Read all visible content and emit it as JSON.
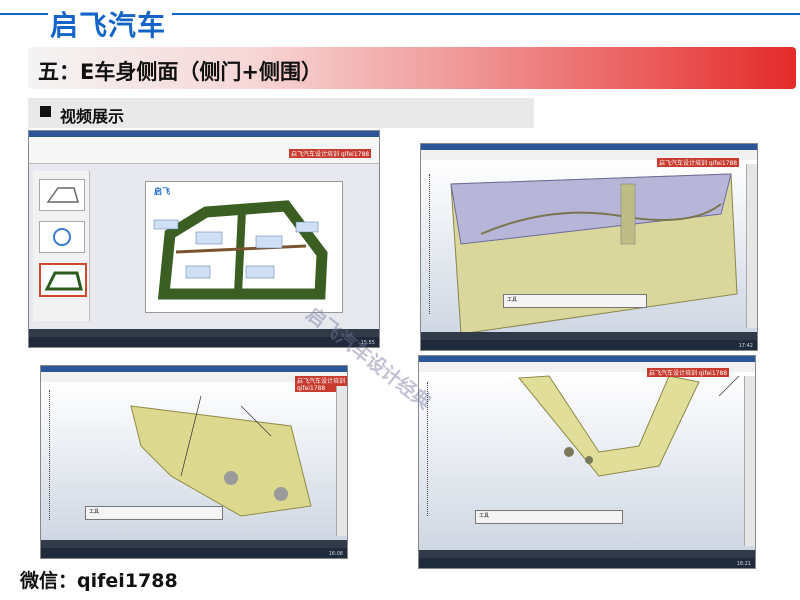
{
  "header": {
    "brand": "启飞汽车",
    "title": "五：E车身侧面（侧门+侧围）",
    "subtitle": "视频展示"
  },
  "footer": {
    "wechat": "微信：qifei1788"
  },
  "watermark": "启飞汽车设计经典",
  "screenshots": [
    {
      "name": "wps-presentation",
      "tag": "启飞汽车设计培训 qifei1788",
      "page_caption": "启飞",
      "time": "15:55"
    },
    {
      "name": "catia-door-panel",
      "tag": "启飞汽车设计培训 qifei1788",
      "dialog": "工具",
      "time": "17:42"
    },
    {
      "name": "catia-side-surface",
      "tag": "启飞汽车设计培训 qifei1788",
      "dialog": "工具",
      "time": "16:08"
    },
    {
      "name": "catia-door-ring",
      "tag": "启飞汽车设计培训 qifei1788",
      "dialog": "工具",
      "time": "18:21"
    }
  ],
  "colors": {
    "brand": "#1565c8",
    "accent": "#e52b2b"
  }
}
